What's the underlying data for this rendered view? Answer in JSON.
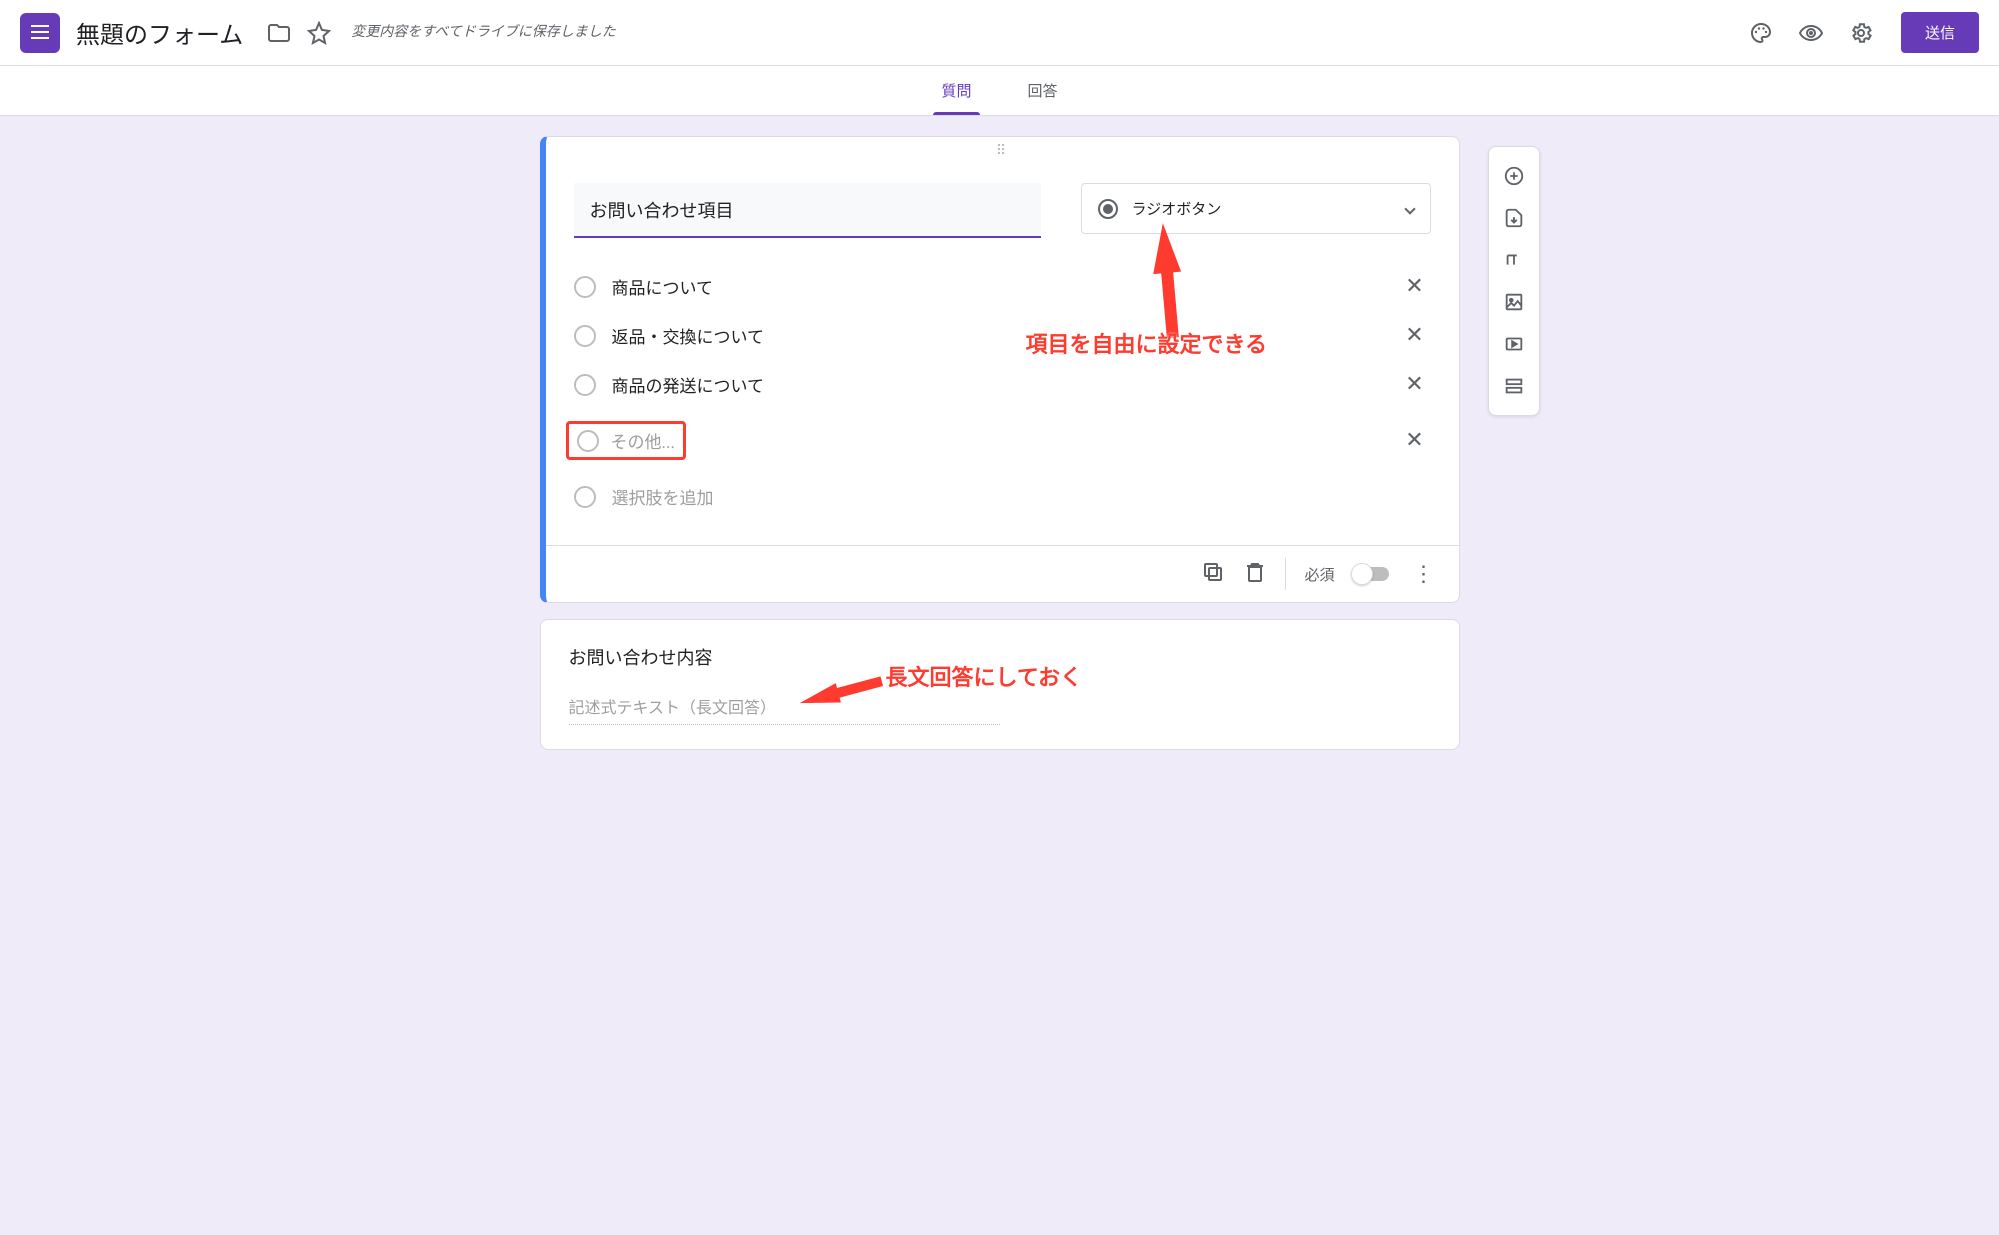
{
  "header": {
    "form_title": "無題のフォーム",
    "save_message": "変更内容をすべてドライブに保存しました",
    "send_button": "送信"
  },
  "tabs": {
    "questions": "質問",
    "responses": "回答"
  },
  "question1": {
    "title": "お問い合わせ項目",
    "type_label": "ラジオボタン",
    "options": [
      "商品について",
      "返品・交換について",
      "商品の発送について"
    ],
    "other_option": "その他...",
    "add_option": "選択肢を追加",
    "required_label": "必須"
  },
  "question2": {
    "title": "お問い合わせ内容",
    "placeholder": "記述式テキスト（長文回答）"
  },
  "annotations": {
    "a1": "項目を自由に設定できる",
    "a2": "長文回答にしておく"
  }
}
